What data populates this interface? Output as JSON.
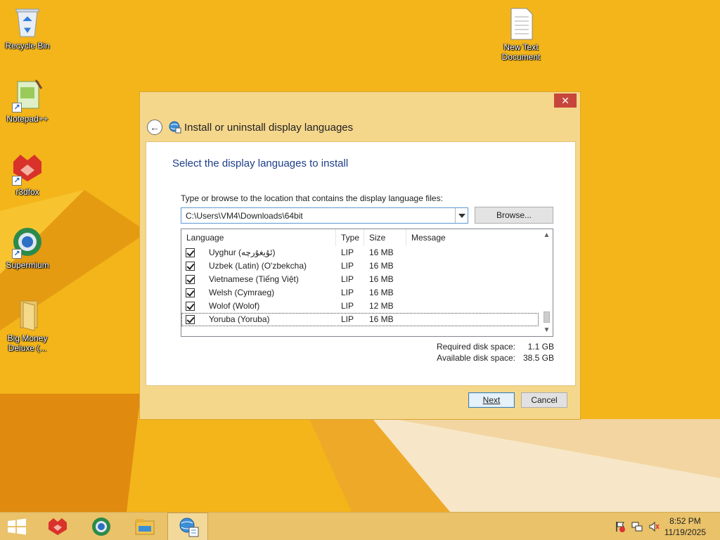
{
  "desktop": {
    "icons": [
      {
        "label": "Recycle Bin",
        "icon": "recycle-bin-icon"
      },
      {
        "label": "Notepad++",
        "icon": "notepad-plus-plus-icon"
      },
      {
        "label": "r3dfox",
        "icon": "r3dfox-icon"
      },
      {
        "label": "Supermium",
        "icon": "supermium-icon"
      },
      {
        "label": "Big Money Deluxe (...",
        "icon": "folder-icon"
      },
      {
        "label": "New Text Document",
        "icon": "text-document-icon"
      }
    ]
  },
  "dialog": {
    "close_label": "✕",
    "back_label": "←",
    "title": "Install or uninstall display languages",
    "heading": "Select the display languages to install",
    "path_prompt": "Type or browse to the location that contains the display language files:",
    "path_value": "C:\\Users\\VM4\\Downloads\\64bit",
    "browse_label": "Browse...",
    "columns": {
      "language": "Language",
      "type": "Type",
      "size": "Size",
      "message": "Message"
    },
    "languages": [
      {
        "name": "Uyghur (ئۇيغۇرچە)",
        "type": "LIP",
        "size": "16 MB",
        "message": "",
        "checked": true
      },
      {
        "name": "Uzbek (Latin) (O'zbekcha)",
        "type": "LIP",
        "size": "16 MB",
        "message": "",
        "checked": true
      },
      {
        "name": "Vietnamese (Tiếng Việt)",
        "type": "LIP",
        "size": "16 MB",
        "message": "",
        "checked": true
      },
      {
        "name": "Welsh (Cymraeg)",
        "type": "LIP",
        "size": "16 MB",
        "message": "",
        "checked": true
      },
      {
        "name": "Wolof (Wolof)",
        "type": "LIP",
        "size": "12 MB",
        "message": "",
        "checked": true
      },
      {
        "name": "Yoruba (Yoruba)",
        "type": "LIP",
        "size": "16 MB",
        "message": "",
        "checked": true
      }
    ],
    "required_label": "Required disk space:",
    "required_value": "1.1 GB",
    "available_label": "Available disk space:",
    "available_value": "38.5 GB",
    "next_label": "Next",
    "cancel_label": "Cancel"
  },
  "taskbar": {
    "apps": [
      {
        "icon": "r3dfox-icon",
        "active": false
      },
      {
        "icon": "supermium-icon",
        "active": false
      },
      {
        "icon": "file-explorer-icon",
        "active": false
      },
      {
        "icon": "language-settings-icon",
        "active": true
      }
    ],
    "tray": [
      "action-center-flag-icon",
      "network-icon",
      "volume-muted-icon"
    ],
    "time": "8:52 PM",
    "date": "11/19/2025"
  },
  "colors": {
    "desktop_background": "#f3b51a",
    "dialog_frame": "#f5d78c",
    "heading_blue": "#1e3e88",
    "close_red": "#c7463b"
  }
}
